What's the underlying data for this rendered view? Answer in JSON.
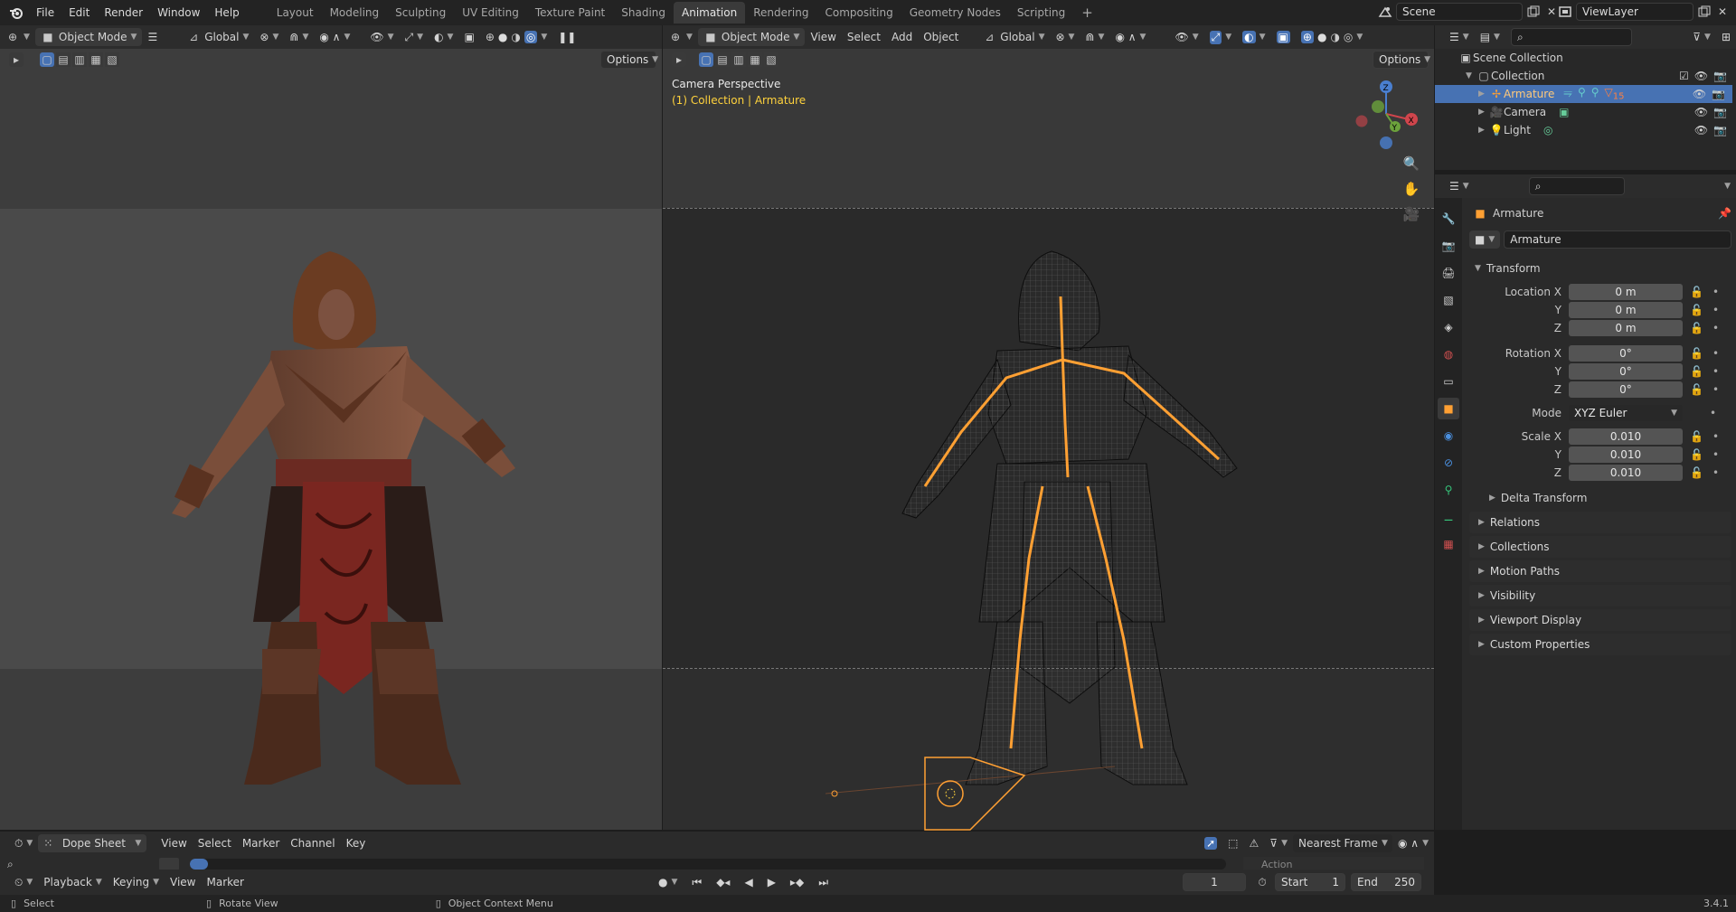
{
  "topbar": {
    "menus": [
      "File",
      "Edit",
      "Render",
      "Window",
      "Help"
    ],
    "workspaces": [
      "Layout",
      "Modeling",
      "Sculpting",
      "UV Editing",
      "Texture Paint",
      "Shading",
      "Animation",
      "Rendering",
      "Compositing",
      "Geometry Nodes",
      "Scripting"
    ],
    "active_workspace": "Animation",
    "add_tab": "+",
    "scene_name": "Scene",
    "view_layer": "ViewLayer"
  },
  "left_viewport": {
    "mode": "Object Mode",
    "orientation": "Global",
    "options_label": "Options"
  },
  "right_viewport": {
    "mode": "Object Mode",
    "menus": [
      "View",
      "Select",
      "Add",
      "Object"
    ],
    "orientation": "Global",
    "options_label": "Options",
    "overlay_title": "Camera Perspective",
    "overlay_sub": "(1) Collection | Armature"
  },
  "outliner": {
    "scene_collection": "Scene Collection",
    "collection": "Collection",
    "items": [
      {
        "name": "Armature",
        "selected": true
      },
      {
        "name": "Camera",
        "selected": false
      },
      {
        "name": "Light",
        "selected": false
      }
    ],
    "armature_badge": "15"
  },
  "properties": {
    "object_name": "Armature",
    "data_name": "Armature",
    "transform_header": "Transform",
    "location": {
      "label_x": "Location X",
      "label_y": "Y",
      "label_z": "Z",
      "x": "0 m",
      "y": "0 m",
      "z": "0 m"
    },
    "rotation": {
      "label_x": "Rotation X",
      "label_y": "Y",
      "label_z": "Z",
      "x": "0°",
      "y": "0°",
      "z": "0°"
    },
    "mode_label": "Mode",
    "mode_value": "XYZ Euler",
    "scale": {
      "label_x": "Scale X",
      "label_y": "Y",
      "label_z": "Z",
      "x": "0.010",
      "y": "0.010",
      "z": "0.010"
    },
    "delta_transform": "Delta Transform",
    "panels": [
      "Relations",
      "Collections",
      "Motion Paths",
      "Visibility",
      "Viewport Display",
      "Custom Properties"
    ]
  },
  "dopesheet": {
    "editor": "Dope Sheet",
    "menus": [
      "View",
      "Select",
      "Marker",
      "Channel",
      "Key"
    ],
    "snap": "Nearest Frame",
    "action_label": "Action"
  },
  "timeline": {
    "menus": [
      "Playback",
      "Keying",
      "View",
      "Marker"
    ],
    "current_frame": "1",
    "start_label": "Start",
    "start": "1",
    "end_label": "End",
    "end": "250"
  },
  "statusbar": {
    "select": "Select",
    "rotate": "Rotate View",
    "context": "Object Context Menu",
    "version": "3.4.1"
  },
  "colors": {
    "accent": "#4772b3",
    "selected_orange": "#ffa033",
    "overlay_yellow": "#ffd23c"
  }
}
